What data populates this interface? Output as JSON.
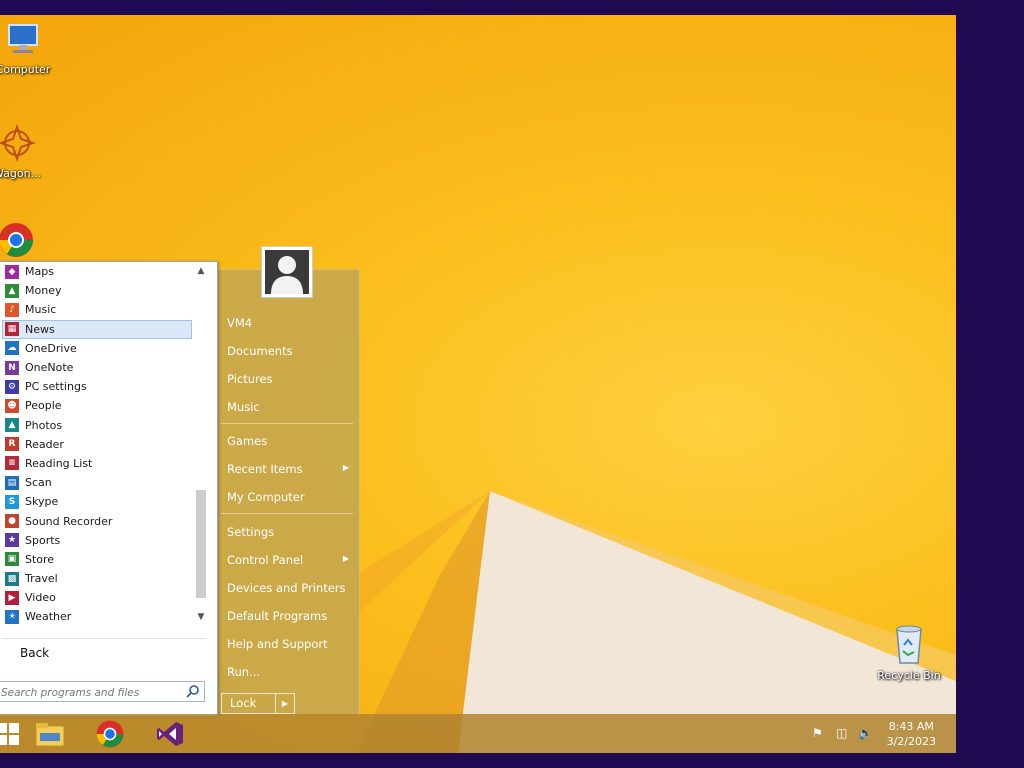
{
  "desktop": {
    "icons": [
      {
        "label": "Computer",
        "icon": "computer-icon"
      },
      {
        "label": "Wagon...",
        "icon": "wagon-icon"
      },
      {
        "label": "Recycle Bin",
        "icon": "recycle-bin-icon"
      }
    ]
  },
  "start_menu": {
    "programs": [
      {
        "label": "Maps",
        "icon": "maps-icon",
        "color": "#9b2a9e"
      },
      {
        "label": "Money",
        "icon": "money-icon",
        "color": "#2f8a3a"
      },
      {
        "label": "Music",
        "icon": "music-icon",
        "color": "#e0562a"
      },
      {
        "label": "News",
        "icon": "news-icon",
        "color": "#b1243a"
      },
      {
        "label": "OneDrive",
        "icon": "onedrive-icon",
        "color": "#1e72c8"
      },
      {
        "label": "OneNote",
        "icon": "onenote-icon",
        "color": "#7a3a9a"
      },
      {
        "label": "PC settings",
        "icon": "pc-settings-icon",
        "color": "#3e3aa8"
      },
      {
        "label": "People",
        "icon": "people-icon",
        "color": "#d0492a"
      },
      {
        "label": "Photos",
        "icon": "photos-icon",
        "color": "#168a8a"
      },
      {
        "label": "Reader",
        "icon": "reader-icon",
        "color": "#c23a2a"
      },
      {
        "label": "Reading List",
        "icon": "reading-list-icon",
        "color": "#b22a3a"
      },
      {
        "label": "Scan",
        "icon": "scan-icon",
        "color": "#1e6cc0"
      },
      {
        "label": "Skype",
        "icon": "skype-icon",
        "color": "#1e9ad8"
      },
      {
        "label": "Sound Recorder",
        "icon": "sound-recorder-icon",
        "color": "#c2432a"
      },
      {
        "label": "Sports",
        "icon": "sports-icon",
        "color": "#5a3a9e"
      },
      {
        "label": "Store",
        "icon": "store-icon",
        "color": "#2e8a3a"
      },
      {
        "label": "Travel",
        "icon": "travel-icon",
        "color": "#1e7a8a"
      },
      {
        "label": "Video",
        "icon": "video-icon",
        "color": "#b21e3a"
      },
      {
        "label": "Weather",
        "icon": "weather-icon",
        "color": "#1e72c8"
      }
    ],
    "selected": "News",
    "back_label": "Back",
    "search_placeholder": "Search programs and files",
    "right": {
      "user": "VM4",
      "documents": "Documents",
      "pictures": "Pictures",
      "music": "Music",
      "games": "Games",
      "recent_items": "Recent Items",
      "my_computer": "My Computer",
      "settings": "Settings",
      "control_panel": "Control Panel",
      "devices_printers": "Devices and Printers",
      "default_programs": "Default Programs",
      "help_support": "Help and Support",
      "run": "Run..."
    },
    "lock_label": "Lock"
  },
  "taskbar": {
    "apps": [
      "windows-start-icon",
      "file-explorer-icon",
      "chrome-icon",
      "visual-studio-icon"
    ],
    "time": "8:43 AM",
    "date": "3/2/2023"
  }
}
